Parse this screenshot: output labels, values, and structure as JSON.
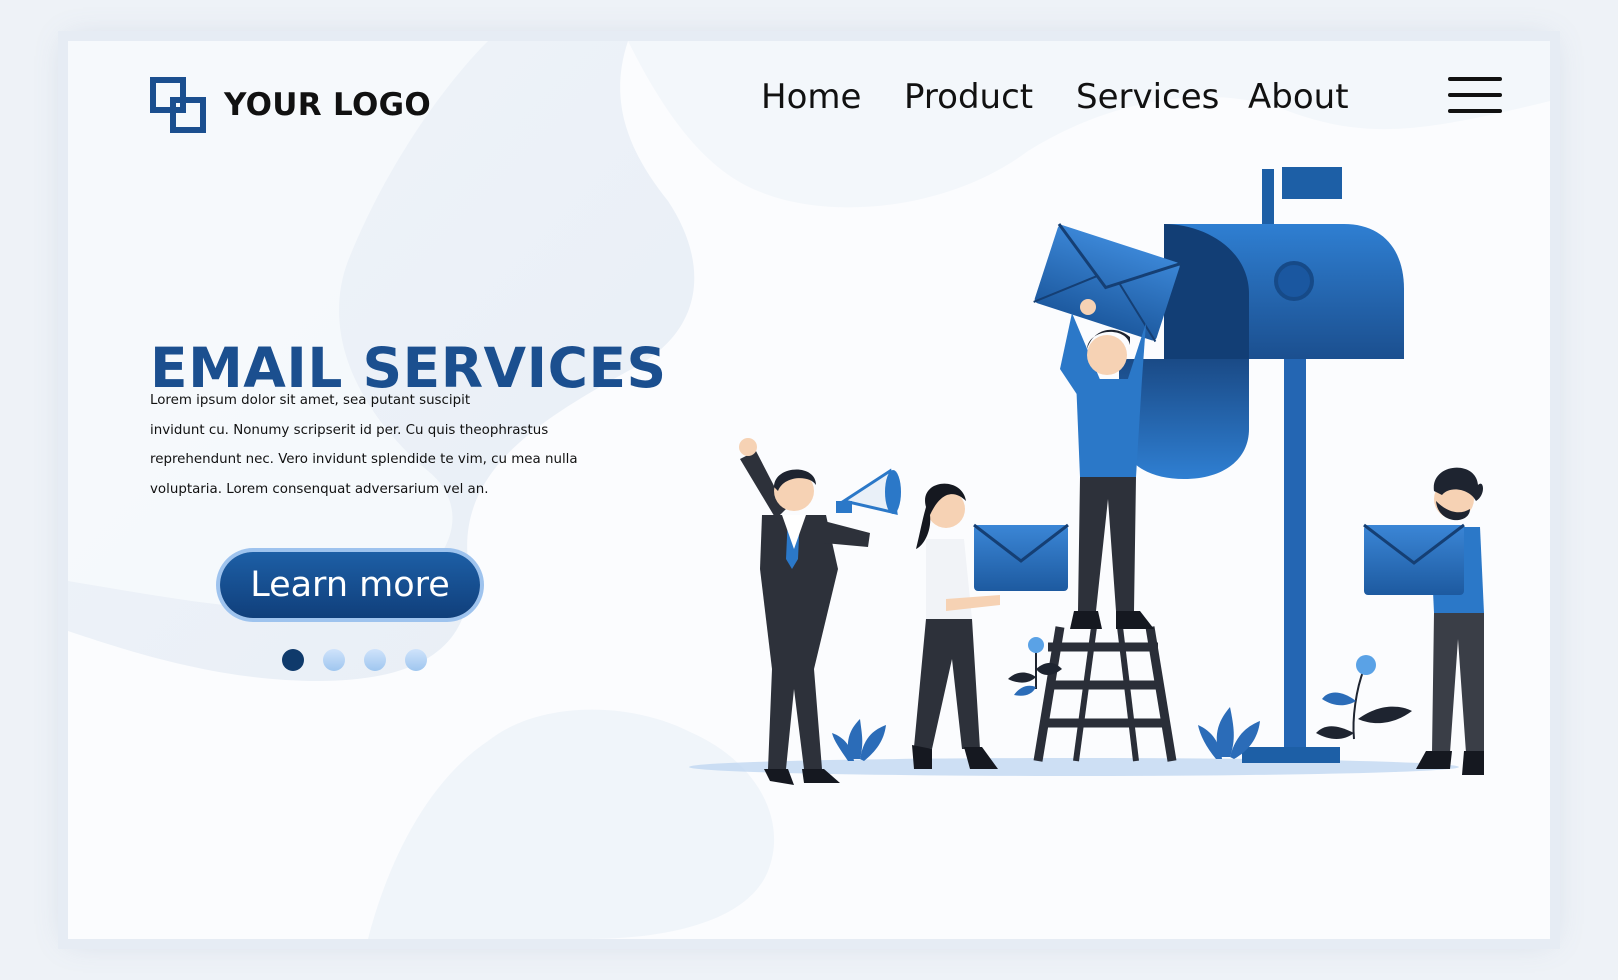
{
  "brand": {
    "logo_text": "YOUR LOGO",
    "primary_color": "#1b4f8f",
    "dark_color": "#0f3a6b",
    "accent_color": "#2b78c8"
  },
  "nav": {
    "items": [
      {
        "label": "Home"
      },
      {
        "label": "Product"
      },
      {
        "label": "Services"
      },
      {
        "label": "About"
      }
    ],
    "menu_icon": "hamburger-menu-icon"
  },
  "hero": {
    "title": "EMAIL SERVICES",
    "body_lines": [
      "Lorem ipsum dolor sit amet, sea putant suscipit",
      "invidunt cu. Nonumy scripserit id per. Cu quis theophrastus",
      "reprehendunt nec. Vero invidunt splendide te vim, cu mea nulla",
      "voluptaria. Lorem consenquat adversarium vel an."
    ],
    "cta_label": "Learn more"
  },
  "carousel": {
    "total_slides": 4,
    "active_index": 0
  },
  "illustration": {
    "subject": "people posting envelopes into a large mailbox",
    "icons": [
      "mailbox-icon",
      "envelope-icon",
      "megaphone-icon",
      "ladder-icon",
      "plant-icon"
    ]
  }
}
